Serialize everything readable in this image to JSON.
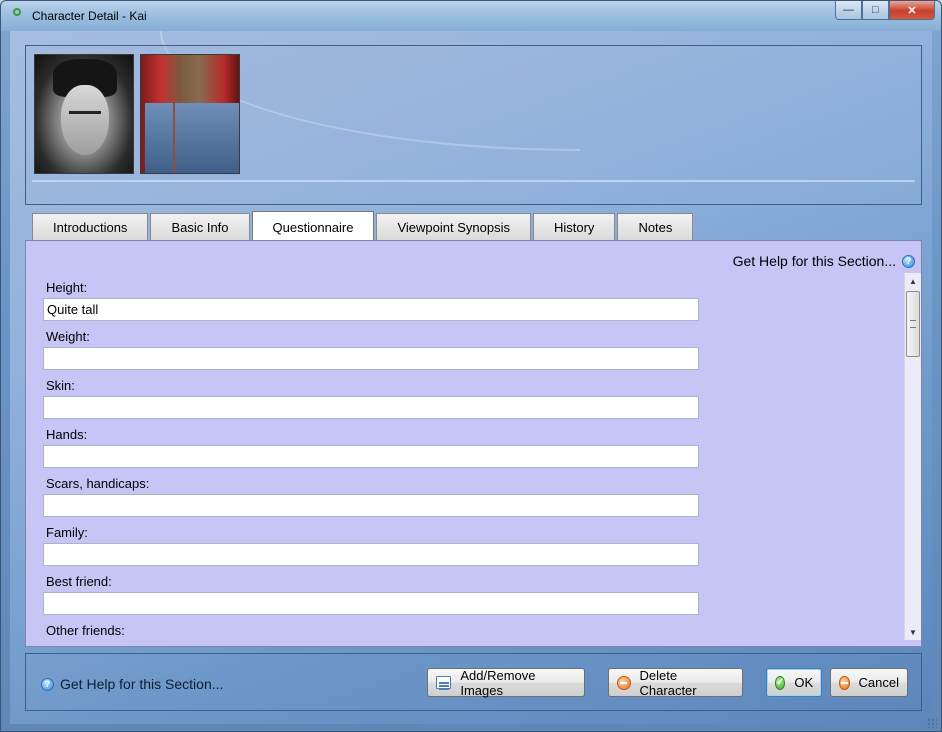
{
  "window": {
    "title": "Character Detail - Kai",
    "minimize_glyph": "—",
    "maximize_glyph": "□",
    "close_glyph": "✕"
  },
  "images": [
    {
      "icon": "portrait-photo",
      "description_alt": "Portrait"
    },
    {
      "icon": "jeans-photo",
      "description_alt": "Photo"
    }
  ],
  "tabs": [
    {
      "label": "Introductions",
      "active": false
    },
    {
      "label": "Basic Info",
      "active": false
    },
    {
      "label": "Questionnaire",
      "active": true
    },
    {
      "label": "Viewpoint Synopsis",
      "active": false
    },
    {
      "label": "History",
      "active": false
    },
    {
      "label": "Notes",
      "active": false
    }
  ],
  "section": {
    "help_link": "Get Help for this Section...",
    "help_icon": "help-icon"
  },
  "fields": [
    {
      "label": "Height:",
      "value": "Quite tall"
    },
    {
      "label": "Weight:",
      "value": ""
    },
    {
      "label": "Skin:",
      "value": ""
    },
    {
      "label": "Hands:",
      "value": ""
    },
    {
      "label": "Scars, handicaps:",
      "value": ""
    },
    {
      "label": "Family:",
      "value": ""
    },
    {
      "label": "Best friend:",
      "value": ""
    },
    {
      "label": "Other friends:",
      "value": ""
    }
  ],
  "footer": {
    "help_link": "Get Help for this Section...",
    "add_remove_images": "Add/Remove Images",
    "delete_character": "Delete Character",
    "ok": "OK",
    "cancel": "Cancel"
  },
  "colors": {
    "content_bg": "#c6c5f6",
    "accent": "#3c7fb1"
  }
}
